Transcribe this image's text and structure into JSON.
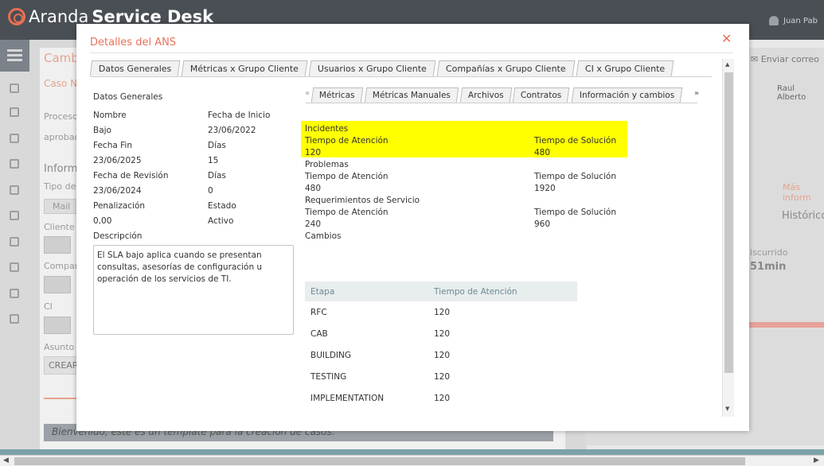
{
  "app": {
    "brand_light": "Aranda ",
    "brand_bold": "Service Desk",
    "user": "Juan Pab"
  },
  "background": {
    "title": "Camb",
    "case_label": "Caso N",
    "texts": [
      "Proceso",
      "aprobac",
      "Inform",
      "Tipo de",
      "Mail",
      "Cliente",
      "Compañ",
      "CI",
      "Asunto",
      "CREAR"
    ],
    "send_mail": "Enviar correo",
    "right_user": "Raul Alberto",
    "more_info": "Más inform",
    "historic": "Histórico",
    "elapsed_label": "iscurrido",
    "elapsed_value": "51min",
    "banner": "Bienvenido, este es un template para la creación de casos."
  },
  "modal": {
    "title": "Detalles del ANS",
    "close_glyph": "✕",
    "tabs": [
      "Datos Generales",
      "Métricas x Grupo Cliente",
      "Usuarios x Grupo Cliente",
      "Compañías x Grupo Cliente",
      "CI x Grupo Cliente"
    ],
    "general": {
      "section": "Datos Generales",
      "nombre_label": "Nombre",
      "nombre_value": "Bajo",
      "fecha_inicio_label": "Fecha de Inicio",
      "fecha_inicio_value": "23/06/2022",
      "fecha_fin_label": "Fecha Fin",
      "fecha_fin_value": "23/06/2025",
      "dias1_label": "Días",
      "dias1_value": "15",
      "fecha_revision_label": "Fecha de Revisión",
      "fecha_revision_value": "23/06/2024",
      "dias2_label": "Días",
      "dias2_value": "0",
      "penalizacion_label": "Penalización",
      "penalizacion_value": "0,00",
      "estado_label": "Estado",
      "estado_value": "Activo",
      "descripcion_label": "Descripción",
      "descripcion_value": "El SLA bajo aplica cuando se presentan consultas, asesorías de configuración u operación de los servicios de TI."
    },
    "subtabs": [
      "Métricas",
      "Métricas Manuales",
      "Archivos",
      "Contratos",
      "Información y cambios"
    ],
    "metrics": {
      "incidentes": {
        "title": "Incidentes",
        "atencion_label": "Tiempo de Atención",
        "atencion_value": "120",
        "solucion_label": "Tiempo de Solución",
        "solucion_value": "480"
      },
      "problemas": {
        "title": "Problemas",
        "atencion_label": "Tiempo de Atención",
        "atencion_value": "480",
        "solucion_label": "Tiempo de Solución",
        "solucion_value": "1920"
      },
      "requerimientos": {
        "title": "Requerimientos de Servicio",
        "atencion_label": "Tiempo de Atención",
        "atencion_value": "240",
        "solucion_label": "Tiempo de Solución",
        "solucion_value": "960"
      },
      "cambios": {
        "title": "Cambios"
      }
    },
    "table": {
      "headers": [
        "Etapa",
        "Tiempo de Atención"
      ],
      "rows": [
        [
          "RFC",
          "120"
        ],
        [
          "CAB",
          "120"
        ],
        [
          "BUILDING",
          "120"
        ],
        [
          "TESTING",
          "120"
        ],
        [
          "IMPLEMENTATION",
          "120"
        ]
      ]
    },
    "highlight_color": "#ffff00",
    "accent_color": "#e8725a"
  }
}
